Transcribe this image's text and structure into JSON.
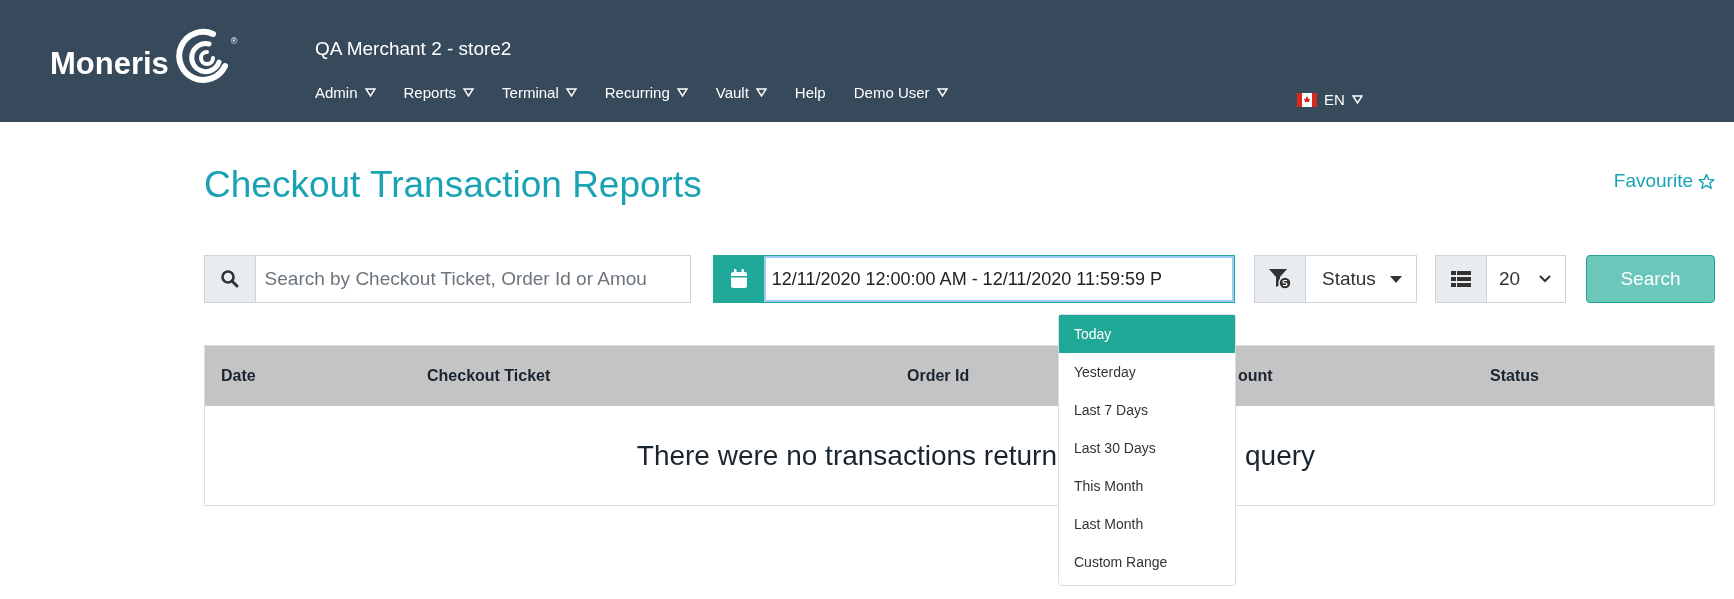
{
  "header": {
    "logo": {
      "text": "Moneris",
      "mark": "®"
    },
    "merchant": "QA Merchant 2 - store2",
    "nav": [
      {
        "label": "Admin",
        "has_menu": true
      },
      {
        "label": "Reports",
        "has_menu": true
      },
      {
        "label": "Terminal",
        "has_menu": true
      },
      {
        "label": "Recurring",
        "has_menu": true
      },
      {
        "label": "Vault",
        "has_menu": true
      },
      {
        "label": "Help",
        "has_menu": false
      },
      {
        "label": "Demo User",
        "has_menu": true
      }
    ],
    "language": {
      "label": "EN"
    }
  },
  "page": {
    "title": "Checkout Transaction Reports",
    "favourite": {
      "label": "Favourite",
      "on": false
    }
  },
  "filters": {
    "search": {
      "placeholder": "Search by Checkout Ticket, Order Id or Amou"
    },
    "date_range": {
      "value": "12/11/2020 12:00:00 AM - 12/11/2020 11:59:59 P"
    },
    "status": {
      "label": "Status"
    },
    "page_size": {
      "value": "20"
    },
    "search_button": "Search"
  },
  "date_menu": [
    {
      "label": "Today",
      "selected": true
    },
    {
      "label": "Yesterday",
      "selected": false
    },
    {
      "label": "Last 7 Days",
      "selected": false
    },
    {
      "label": "Last 30 Days",
      "selected": false
    },
    {
      "label": "This Month",
      "selected": false
    },
    {
      "label": "Last Month",
      "selected": false
    },
    {
      "label": "Custom Range",
      "selected": false
    }
  ],
  "table": {
    "columns": [
      "Date",
      "Checkout Ticket",
      "Order Id",
      "ount",
      "Status"
    ],
    "message_before": "There were no transactions return",
    "message_after": "query"
  }
}
